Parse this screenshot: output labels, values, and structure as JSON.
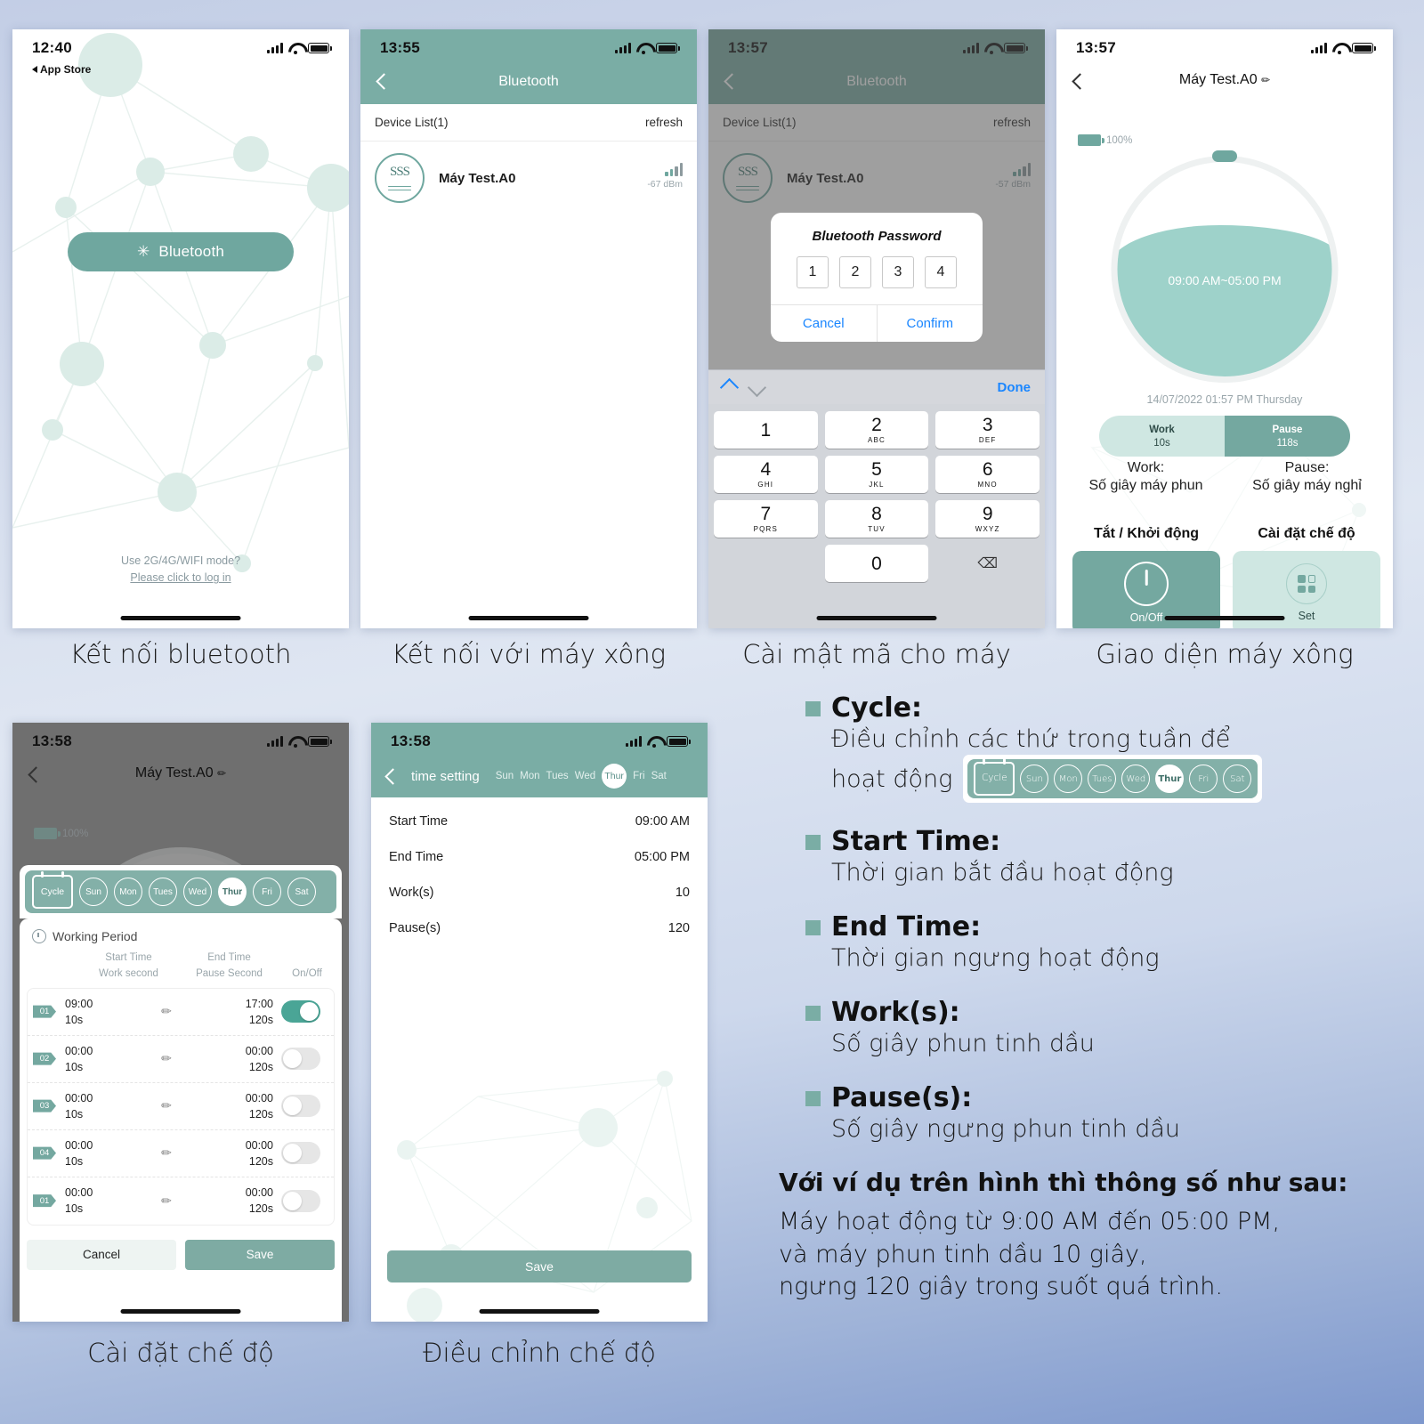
{
  "theme": {
    "teal": "#7aada5",
    "teal_dark": "#6fa79f",
    "teal_light": "#cfe7e2",
    "blue_link": "#1a86ff"
  },
  "phone1": {
    "status": {
      "time": "12:40",
      "back_app": "App Store"
    },
    "bluetooth_button": "Bluetooth",
    "login_line1": "Use 2G/4G/WIFI mode?",
    "login_line2": "Please click to log in",
    "caption": "Kết nối bluetooth"
  },
  "phone2": {
    "status": {
      "time": "13:55"
    },
    "nav_title": "Bluetooth",
    "device_list_label": "Device List(1)",
    "refresh_label": "refresh",
    "device": {
      "icon_text": "SSS",
      "name": "Máy Test.A0",
      "rssi": "-67 dBm"
    },
    "caption": "Kết nối với máy xông"
  },
  "phone3": {
    "status": {
      "time": "13:57"
    },
    "nav_title": "Bluetooth",
    "device_list_label": "Device List(1)",
    "refresh_label": "refresh",
    "device": {
      "icon_text": "SSS",
      "name": "Máy Test.A0",
      "rssi": "-57 dBm"
    },
    "dialog": {
      "title": "Bluetooth Password",
      "digits": [
        "1",
        "2",
        "3",
        "4"
      ],
      "cancel": "Cancel",
      "confirm": "Confirm"
    },
    "keyboard": {
      "done": "Done",
      "keys": [
        {
          "n": "1",
          "s": ""
        },
        {
          "n": "2",
          "s": "ABC"
        },
        {
          "n": "3",
          "s": "DEF"
        },
        {
          "n": "4",
          "s": "GHI"
        },
        {
          "n": "5",
          "s": "JKL"
        },
        {
          "n": "6",
          "s": "MNO"
        },
        {
          "n": "7",
          "s": "PQRS"
        },
        {
          "n": "8",
          "s": "TUV"
        },
        {
          "n": "9",
          "s": "WXYZ"
        },
        {
          "n": "0",
          "s": ""
        }
      ],
      "delete_icon": "⌫"
    },
    "caption": "Cài mật mã cho máy"
  },
  "phone4": {
    "status": {
      "time": "13:57"
    },
    "title": "Máy Test.A0",
    "battery": "100%",
    "dial_text": "09:00 AM~05:00 PM",
    "datetime": "14/07/2022 01:57 PM Thursday",
    "work": {
      "label": "Work",
      "value": "10s"
    },
    "pause": {
      "label": "Pause",
      "value": "118s"
    },
    "legend_work": "Work:",
    "legend_work_desc": "Số giây máy phun",
    "legend_pause": "Pause:",
    "legend_pause_desc": "Số giây máy nghỉ",
    "onoff": {
      "title": "Tắt / Khởi động",
      "caption": "On/Off"
    },
    "set": {
      "title": "Cài đặt chế độ",
      "caption": "Set"
    },
    "caption": "Giao diện máy xông"
  },
  "phone5": {
    "status": {
      "time": "13:58"
    },
    "title": "Máy Test.A0",
    "battery": "100%",
    "cycle_label": "Cycle",
    "days": [
      "Sun",
      "Mon",
      "Tues",
      "Wed",
      "Thur",
      "Fri",
      "Sat"
    ],
    "selected_day": "Thur",
    "working_period": "Working Period",
    "columns": {
      "start": "Start Time",
      "end": "End Time",
      "work": "Work second",
      "pause": "Pause Second",
      "onoff": "On/Off"
    },
    "rows": [
      {
        "id": "01",
        "start": "09:00",
        "work": "10s",
        "end": "17:00",
        "pause": "120s",
        "on": true
      },
      {
        "id": "02",
        "start": "00:00",
        "work": "10s",
        "end": "00:00",
        "pause": "120s",
        "on": false
      },
      {
        "id": "03",
        "start": "00:00",
        "work": "10s",
        "end": "00:00",
        "pause": "120s",
        "on": false
      },
      {
        "id": "04",
        "start": "00:00",
        "work": "10s",
        "end": "00:00",
        "pause": "120s",
        "on": false
      },
      {
        "id": "01",
        "start": "00:00",
        "work": "10s",
        "end": "00:00",
        "pause": "120s",
        "on": false
      }
    ],
    "cancel": "Cancel",
    "save": "Save",
    "caption": "Cài đặt chế độ"
  },
  "phone6": {
    "status": {
      "time": "13:58"
    },
    "nav_title": "time setting",
    "days": [
      "Sun",
      "Mon",
      "Tues",
      "Wed",
      "Thur",
      "Fri",
      "Sat"
    ],
    "selected_day": "Thur",
    "settings": [
      {
        "label": "Start Time",
        "value": "09:00 AM"
      },
      {
        "label": "End Time",
        "value": "05:00 PM"
      },
      {
        "label": "Work(s)",
        "value": "10"
      },
      {
        "label": "Pause(s)",
        "value": "120"
      }
    ],
    "save": "Save",
    "caption": "Điều chỉnh chế độ"
  },
  "panel": {
    "cycle": {
      "head": "Cycle:",
      "body_line1": "Điều chỉnh các thứ trong tuần để",
      "body_line2": "hoạt động",
      "chip_label": "Cycle",
      "chip_days": [
        "Sun",
        "Mon",
        "Tues",
        "Wed",
        "Thur",
        "Fri",
        "Sat"
      ],
      "chip_selected": "Thur"
    },
    "start_time": {
      "head": "Start Time:",
      "body": "Thời gian bắt đầu hoạt động"
    },
    "end_time": {
      "head": "End Time:",
      "body": "Thời gian ngưng hoạt động"
    },
    "works": {
      "head": "Work(s):",
      "body": "Số giây phun tinh dầu"
    },
    "pauses": {
      "head": "Pause(s):",
      "body": "Số giây ngưng phun tinh dầu"
    },
    "summary_head": "Với ví dụ trên hình thì thông số như sau:",
    "summary_line1": "Máy hoạt động từ 9:00 AM đến 05:00 PM,",
    "summary_line2": "và máy phun tinh dầu 10 giây,",
    "summary_line3": "ngưng 120 giây trong suốt quá trình."
  }
}
